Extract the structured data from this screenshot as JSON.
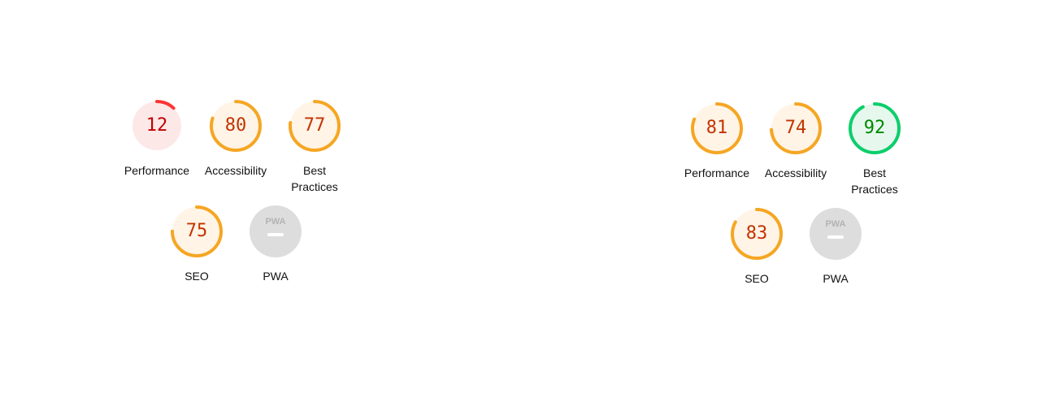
{
  "colors": {
    "fail": "#ff3333",
    "fail_bg": "#fde8e8",
    "fail_text": "#c00000",
    "average": "#f5a623",
    "average_bg": "#fff4e6",
    "average_text": "#c33300",
    "pass": "#0cce6b",
    "pass_bg": "#e6f8ee",
    "pass_text": "#008800",
    "na": "#dddddd",
    "na_text": "#b3b3b3"
  },
  "reports": [
    {
      "gauges": [
        {
          "label": "Performance",
          "score": 12,
          "status": "fail"
        },
        {
          "label": "Accessibility",
          "score": 80,
          "status": "average"
        },
        {
          "label": "Best\nPractices",
          "score": 77,
          "status": "average"
        },
        {
          "label": "SEO",
          "score": 75,
          "status": "average"
        },
        {
          "label": "PWA",
          "badge_text": "PWA",
          "status": "na",
          "icon": "pwa-badge-icon"
        }
      ]
    },
    {
      "gauges": [
        {
          "label": "Performance",
          "score": 81,
          "status": "average"
        },
        {
          "label": "Accessibility",
          "score": 74,
          "status": "average"
        },
        {
          "label": "Best\nPractices",
          "score": 92,
          "status": "pass"
        },
        {
          "label": "SEO",
          "score": 83,
          "status": "average"
        },
        {
          "label": "PWA",
          "badge_text": "PWA",
          "status": "na",
          "icon": "pwa-badge-icon"
        }
      ]
    }
  ]
}
